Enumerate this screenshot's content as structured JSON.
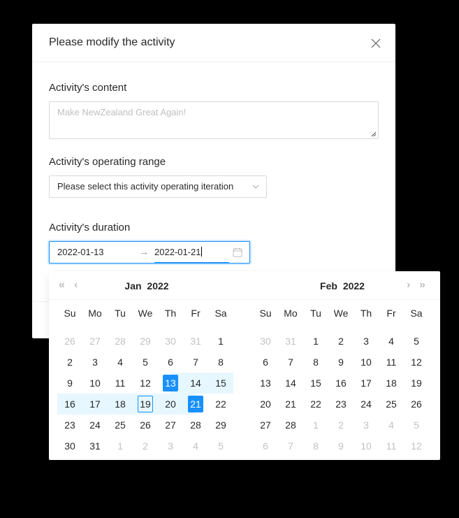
{
  "modal": {
    "title": "Please modify the activity",
    "content_label": "Activity's content",
    "content_placeholder": "Make NewZealand Great Again!",
    "range_label": "Activity's operating range",
    "range_select_placeholder": "Please select this activity operating iteration",
    "duration_label": "Activity's duration",
    "start_date": "2022-01-13",
    "end_date": "2022-01-21",
    "separator": "→"
  },
  "calendar": {
    "weekdays": [
      "Su",
      "Mo",
      "Tu",
      "We",
      "Th",
      "Fr",
      "Sa"
    ],
    "nav": {
      "super_prev": "«",
      "prev": "‹",
      "next": "›",
      "super_next": "»"
    },
    "left": {
      "month": "Jan",
      "year": "2022",
      "days": [
        [
          "26",
          "27",
          "28",
          "29",
          "30",
          "31",
          "1"
        ],
        [
          "2",
          "3",
          "4",
          "5",
          "6",
          "7",
          "8"
        ],
        [
          "9",
          "10",
          "11",
          "12",
          "13",
          "14",
          "15"
        ],
        [
          "16",
          "17",
          "18",
          "19",
          "20",
          "21",
          "22"
        ],
        [
          "23",
          "24",
          "25",
          "26",
          "27",
          "28",
          "29"
        ],
        [
          "30",
          "31",
          "1",
          "2",
          "3",
          "4",
          "5"
        ]
      ]
    },
    "right": {
      "month": "Feb",
      "year": "2022",
      "days": [
        [
          "30",
          "31",
          "1",
          "2",
          "3",
          "4",
          "5"
        ],
        [
          "6",
          "7",
          "8",
          "9",
          "10",
          "11",
          "12"
        ],
        [
          "13",
          "14",
          "15",
          "16",
          "17",
          "18",
          "19"
        ],
        [
          "20",
          "21",
          "22",
          "23",
          "24",
          "25",
          "26"
        ],
        [
          "27",
          "28",
          "1",
          "2",
          "3",
          "4",
          "5"
        ],
        [
          "6",
          "7",
          "8",
          "9",
          "10",
          "11",
          "12"
        ]
      ]
    },
    "today": "2022-01-19",
    "accent_color": "#1890ff",
    "range_color": "#e6f7ff"
  }
}
